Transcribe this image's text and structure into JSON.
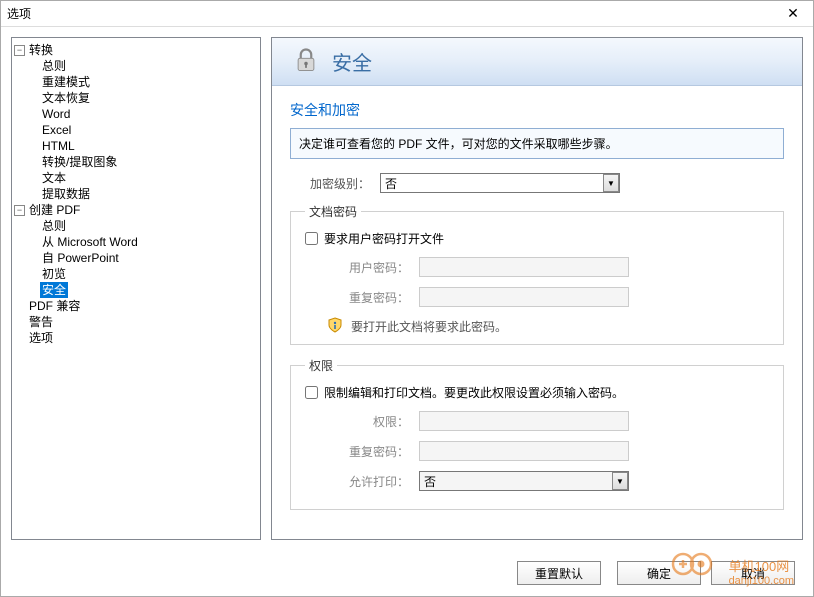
{
  "window": {
    "title": "选项",
    "close": "✕"
  },
  "tree": {
    "convert": {
      "label": "转换",
      "children": {
        "general": "总则",
        "rebuild": "重建模式",
        "textrecover": "文本恢复",
        "word": "Word",
        "excel": "Excel",
        "html": "HTML",
        "extractimg": "转换/提取图象",
        "text": "文本",
        "extractdata": "提取数据"
      }
    },
    "create": {
      "label": "创建 PDF",
      "children": {
        "general": "总则",
        "fromword": "从 Microsoft Word",
        "frompp": "自 PowerPoint",
        "preview": "初览",
        "security": "安全"
      }
    },
    "compat": "PDF 兼容",
    "warn": "警告",
    "options": "选项"
  },
  "page": {
    "headerTitle": "安全",
    "sectionTitle": "安全和加密",
    "infoText": "决定谁可查看您的 PDF 文件，可对您的文件采取哪些步骤。",
    "encryptLabel": "加密级别：",
    "encryptValue": "否",
    "docpw": {
      "legend": "文档密码",
      "check": "要求用户密码打开文件",
      "userPw": "用户密码：",
      "repeatPw": "重复密码：",
      "hint": "要打开此文档将要求此密码。"
    },
    "perm": {
      "legend": "权限",
      "check": "限制编辑和打印文档。要更改此权限设置必须输入密码。",
      "permPw": "权限：",
      "repeatPw": "重复密码：",
      "allowPrint": "允许打印：",
      "allowPrintValue": "否"
    }
  },
  "footer": {
    "reset": "重置默认",
    "ok": "确定",
    "cancel": "取消"
  },
  "watermark": {
    "site": "danji100.com",
    "brand": "单机100网"
  }
}
